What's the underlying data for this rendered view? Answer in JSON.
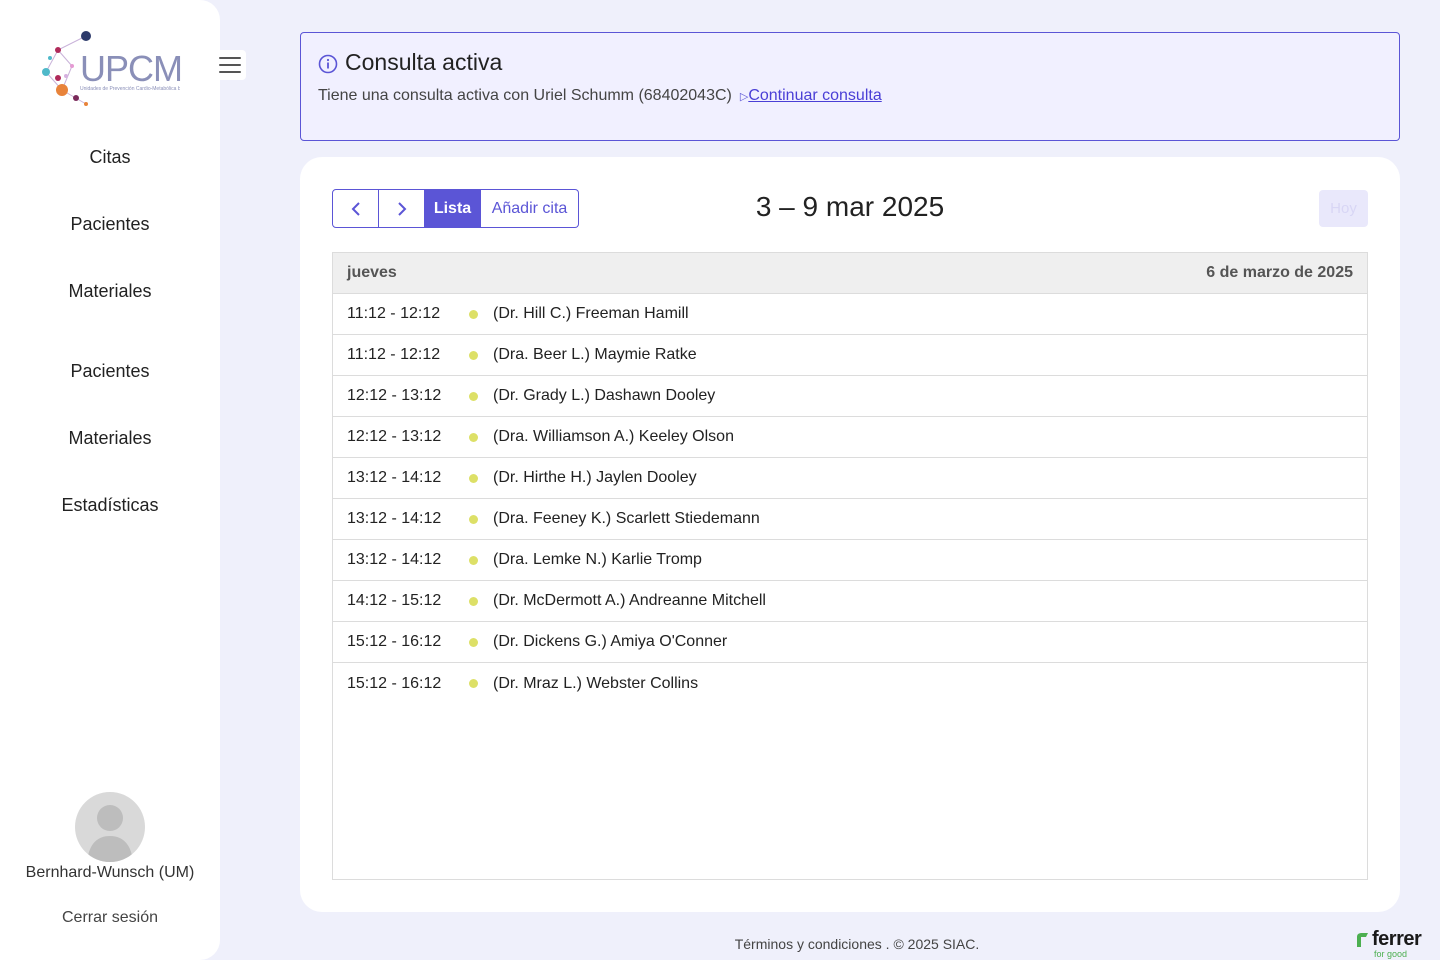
{
  "app": {
    "logo_text": "UPCM",
    "logo_subtitle": "Unidades de Prevención Cardio-Metabólica by SIAC"
  },
  "sidebar": {
    "items": [
      {
        "label": "Citas"
      },
      {
        "label": "Pacientes"
      },
      {
        "label": "Materiales"
      },
      {
        "label": "Pacientes"
      },
      {
        "label": "Materiales"
      },
      {
        "label": "Estadísticas"
      }
    ],
    "user_name": "Bernhard-Wunsch (UM)",
    "logout_label": "Cerrar sesión"
  },
  "alert": {
    "title": "Consulta activa",
    "text": "Tiene una consulta activa con Uriel Schumm (68402043C)",
    "link_label": "Continuar consulta"
  },
  "calendar": {
    "buttons": {
      "prev": "‹",
      "next": "›",
      "list": "Lista",
      "add": "Añadir cita",
      "today": "Hoy"
    },
    "range_title": "3 – 9 mar 2025",
    "day": {
      "weekday": "jueves",
      "date": "6 de marzo de 2025"
    },
    "appointments": [
      {
        "time": "11:12 - 12:12",
        "title": "(Dr. Hill C.) Freeman Hamill"
      },
      {
        "time": "11:12 - 12:12",
        "title": "(Dra. Beer L.) Maymie Ratke"
      },
      {
        "time": "12:12 - 13:12",
        "title": "(Dr. Grady L.) Dashawn Dooley"
      },
      {
        "time": "12:12 - 13:12",
        "title": "(Dra. Williamson A.) Keeley Olson"
      },
      {
        "time": "13:12 - 14:12",
        "title": "(Dr. Hirthe H.) Jaylen Dooley"
      },
      {
        "time": "13:12 - 14:12",
        "title": "(Dra. Feeney K.) Scarlett Stiedemann"
      },
      {
        "time": "13:12 - 14:12",
        "title": "(Dra. Lemke N.) Karlie Tromp"
      },
      {
        "time": "14:12 - 15:12",
        "title": "(Dr. McDermott A.) Andreanne Mitchell"
      },
      {
        "time": "15:12 - 16:12",
        "title": "(Dr. Dickens G.) Amiya O'Conner"
      },
      {
        "time": "15:12 - 16:12",
        "title": "(Dr. Mraz L.) Webster Collins"
      }
    ]
  },
  "footer": {
    "terms_label": "Términos y condiciones",
    "copyright": " . © 2025 SIAC."
  },
  "brand": {
    "name": "ferrer",
    "tagline": "for good"
  },
  "colors": {
    "accent": "#5b55d6",
    "background": "#eff0fb",
    "event_dot": "#dde067"
  }
}
